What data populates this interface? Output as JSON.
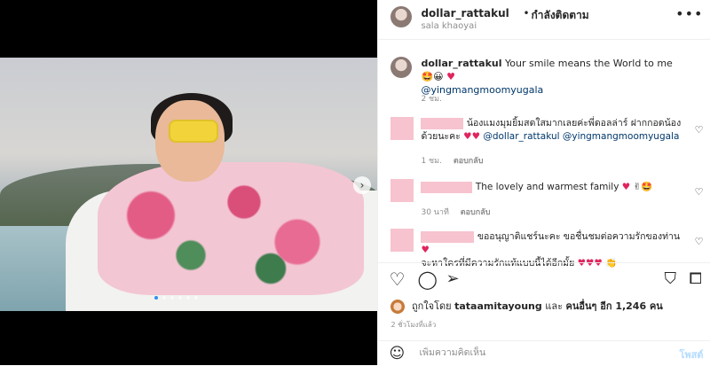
{
  "header": {
    "username": "dollar_rattakul",
    "separator": "•",
    "follow_state": "กำลังติดตาม",
    "location": "sala khaoyai",
    "more_icon": "more-icon"
  },
  "media": {
    "next_icon": "chevron-right-icon",
    "dots_count": 6,
    "active_dot": 1
  },
  "caption": {
    "username": "dollar_rattakul",
    "text": "Your smile means the World to me 🤩😀",
    "mention": "@yingmangmoomyugala",
    "time": "2 ชม."
  },
  "comments": [
    {
      "text": "น้องแมงมุมยิ้มสดใสมากเลยค่ะพี่ดอลล่าร์ ฝากกอดน้องด้วยนะคะ",
      "mentions": "@dollar_rattakul @yingmangmoomyugala",
      "time": "1 ชม.",
      "reply": "ตอบกลับ"
    },
    {
      "text": "The lovely and warmest family",
      "emojis": "✌🤩",
      "time": "30 นาที",
      "reply": "ตอบกลับ"
    },
    {
      "text": "ขออนุญาติแชร์นะคะ ขอชื่นชมต่อความรักของท่าน",
      "text2": "จะหาใครที่มีความรักแท้แบบนี้ได้อีกมั้ย",
      "emojis2": "👏"
    }
  ],
  "actions": {
    "like_icon": "heart-icon",
    "comment_icon": "comment-icon",
    "share_icon": "send-icon",
    "save_icon": "bookmark-icon"
  },
  "likes": {
    "prefix": "ถูกใจโดย",
    "user": "tataamitayoung",
    "and": "และ",
    "others": "คนอื่นๆ อีก 1,246 คน"
  },
  "posted_time": "2 ชั่วโมงที่แล้ว",
  "comment_box": {
    "placeholder": "เพิ่มความคิดเห็น",
    "post_label": "โพสต์"
  },
  "colors": {
    "link": "#00376b",
    "heart": "#e0245e",
    "post_button": "#b3dbff",
    "redaction": "#f6c3cf"
  }
}
